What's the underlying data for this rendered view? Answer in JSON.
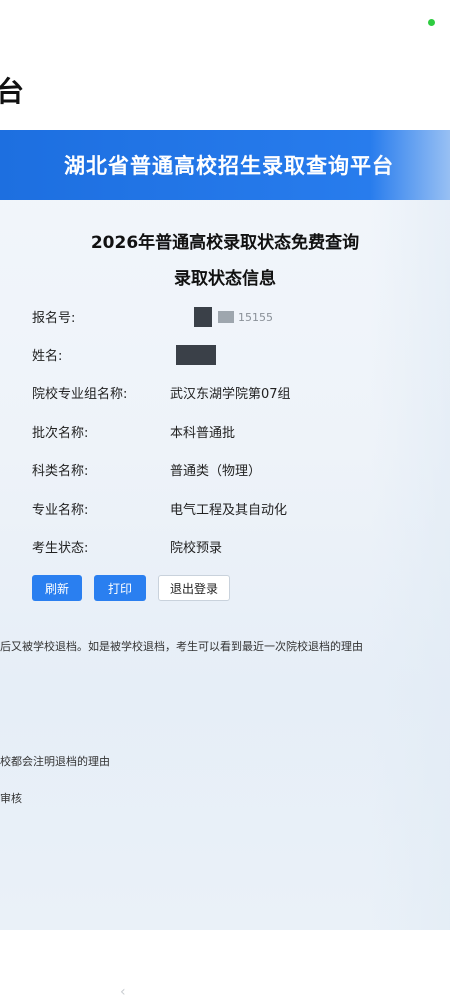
{
  "status_bar": {
    "indicator_color": "#2ecc40"
  },
  "page": {
    "background_title": "台"
  },
  "photo": {
    "banner_title": "湖北省普通高校招生录取查询平台",
    "heading": "2026年普通高校录取状态免费查询",
    "subheading": "录取状态信息",
    "fields": [
      {
        "label": "报名号:",
        "value": "15155"
      },
      {
        "label": "姓名:",
        "value": ""
      },
      {
        "label": "院校专业组名称:",
        "value": "武汉东湖学院第07组"
      },
      {
        "label": "批次名称:",
        "value": "本科普通批"
      },
      {
        "label": "科类名称:",
        "value": "普通类（物理）"
      },
      {
        "label": "专业名称:",
        "value": "电气工程及其自动化"
      },
      {
        "label": "考生状态:",
        "value": "院校预录"
      }
    ],
    "buttons": {
      "refresh": "刷新",
      "print": "打印",
      "logout": "退出登录"
    },
    "notes": [
      "后又被学校退档。如是被学校退档，考生可以看到最近一次院校退档的理由",
      "校都会注明退档的理由",
      "审核"
    ]
  },
  "nav": {
    "back": "‹"
  },
  "colors": {
    "banner": "#2a7ff0",
    "button_primary": "#2a7ff0"
  }
}
